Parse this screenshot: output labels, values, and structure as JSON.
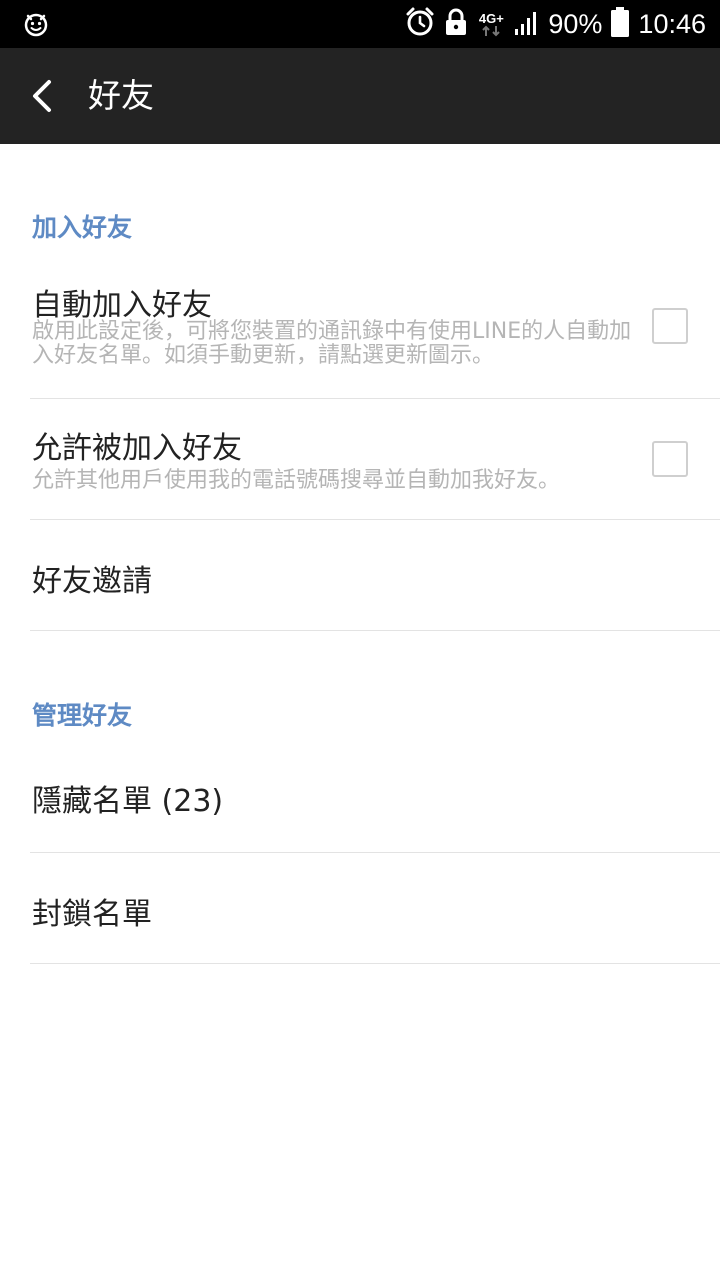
{
  "status_bar": {
    "left_icon": "smiley-notification-icon",
    "network_label": "4G+",
    "battery_percent": "90%",
    "time": "10:46"
  },
  "app_bar": {
    "back_icon": "chevron-left-icon",
    "title": "好友"
  },
  "sections": [
    {
      "header": "加入好友",
      "items": [
        {
          "title": "自動加入好友",
          "description": "啟用此設定後，可將您裝置的通訊錄中有使用LINE的人自動加入好友名單。如須手動更新，請點選更新圖示。",
          "checked": false
        },
        {
          "title": "允許被加入好友",
          "description": "允許其他用戶使用我的電話號碼搜尋並自動加我好友。",
          "checked": false
        },
        {
          "title": "好友邀請"
        }
      ]
    },
    {
      "header": "管理好友",
      "items": [
        {
          "title": "隱藏名單 (23)"
        },
        {
          "title": "封鎖名單"
        }
      ]
    }
  ],
  "colors": {
    "status_bar_bg": "#000000",
    "app_bar_bg": "#232323",
    "section_header": "#5e8ac4",
    "title_text": "#222222",
    "description_text": "#b5b5b5",
    "divider": "#e3e3e3"
  }
}
